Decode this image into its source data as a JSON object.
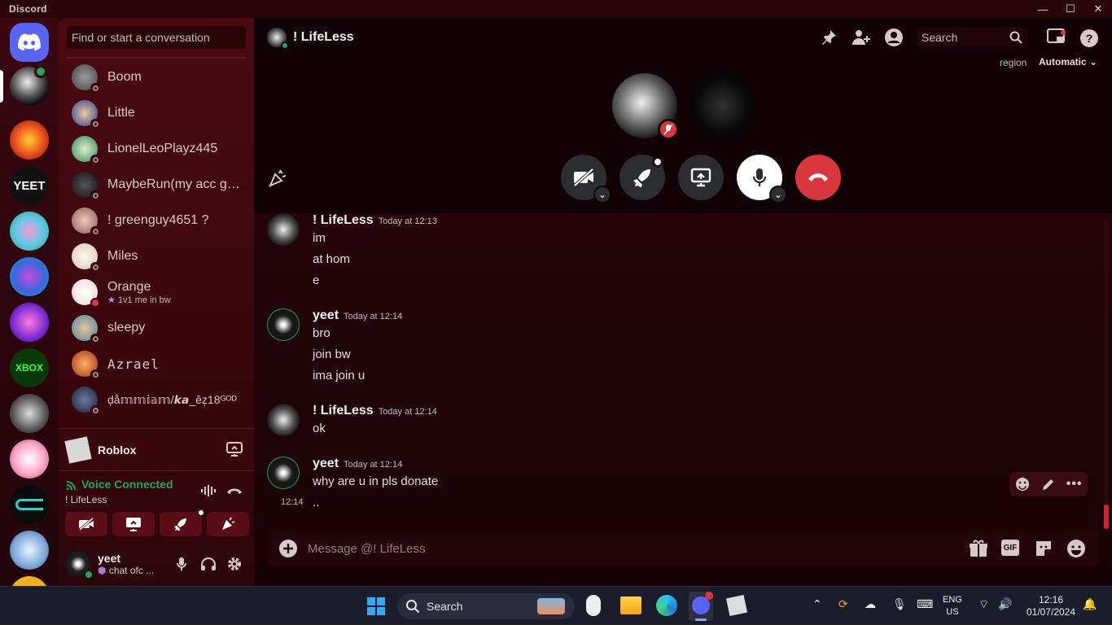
{
  "app": {
    "title": "Discord"
  },
  "window_controls": {
    "minimize": "—",
    "maximize": "☐",
    "close": "✕"
  },
  "dm_sidebar": {
    "search_placeholder": "Find or start a conversation",
    "dms": [
      {
        "name": "Boom",
        "status": "offline"
      },
      {
        "name": "Little",
        "status": "offline"
      },
      {
        "name": "LionelLeoPlayz445",
        "status": "offline"
      },
      {
        "name": "MaybeRun(my acc got...",
        "status": "offline"
      },
      {
        "name": "! greenguy4651 ?",
        "status": "offline"
      },
      {
        "name": "Miles",
        "status": "offline"
      },
      {
        "name": "Orange",
        "status": "dnd",
        "activity": "1v1 me in bw"
      },
      {
        "name": "sleepy",
        "status": "offline"
      },
      {
        "name": "Azrael",
        "status": "offline"
      },
      {
        "name": "ḑå𝕞𝕞𝕚𝕒𝕞/𝙠𝙖_ĕẓ18ᴳᴼᴰ",
        "status": "offline"
      }
    ],
    "activity": {
      "name": "Roblox"
    },
    "voice": {
      "status": "Voice Connected",
      "channel": "! LifeLess"
    },
    "user": {
      "name": "yeet",
      "status_text": "chat ofc ..."
    }
  },
  "header": {
    "name": "! LifeLess",
    "search_placeholder": "Search",
    "region_label": "region",
    "region_value": "Automatic"
  },
  "messages": [
    {
      "author": "! LifeLess",
      "time": "Today at 12:13",
      "lines": [
        "im",
        "at hom",
        "e"
      ]
    },
    {
      "author": "yeet",
      "time": "Today at 12:14",
      "lines": [
        "bro",
        "join bw",
        "ima join u"
      ]
    },
    {
      "author": "! LifeLess",
      "time": "Today at 12:14",
      "lines": [
        "ok"
      ]
    },
    {
      "author": "yeet",
      "time": "Today at 12:14",
      "lines": [
        "why are u in pls donate"
      ]
    }
  ],
  "followup": {
    "time": "12:14",
    "text": ".."
  },
  "composer": {
    "placeholder": "Message @! LifeLess"
  },
  "taskbar": {
    "search_label": "Search",
    "lang": "ENG",
    "region": "US",
    "clock_time": "12:16",
    "clock_date": "01/07/2024"
  },
  "colors": {
    "accent": "#5865f2",
    "danger": "#da373c",
    "online": "#23a55a",
    "voice_green": "#23a55a",
    "bg": "#2a0509"
  }
}
